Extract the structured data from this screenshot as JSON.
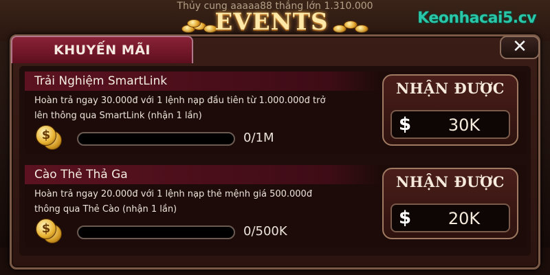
{
  "header": {
    "ticker_text": "Thủy cung aaaaa88 thắng lớn 1.310.000",
    "events_title": "EVENTS",
    "watermark": "Keonhacai5.cv"
  },
  "panel": {
    "tab_label": "KHUYẾN MÃI",
    "close_label": "✕"
  },
  "promotions": [
    {
      "title": "Trải Nghiệm SmartLink",
      "description_line1": "Hoàn trả ngay 30.000đ với 1 lệnh nạp đầu tiên từ 1.000.000đ trở",
      "description_line2": "lên thông qua SmartLink (nhận 1 lần)",
      "progress_text": "0/1M",
      "progress_fraction": 0,
      "reward_title": "NHẬN ĐƯỢC",
      "reward_amount": "30K",
      "coin_symbol": "$",
      "currency_symbol": "$"
    },
    {
      "title": "Cào Thẻ Thả Ga",
      "description_line1": "Hoàn trả ngay 20.000đ với 1 lệnh nạp thẻ mệnh giá 500.000đ",
      "description_line2": "thông qua Thẻ Cào (nhận 1 lần)",
      "progress_text": "0/500K",
      "progress_fraction": 0,
      "reward_title": "NHẬN ĐƯỢC",
      "reward_amount": "20K",
      "coin_symbol": "$",
      "currency_symbol": "$"
    }
  ],
  "colors": {
    "tab_bg": "#8a2236",
    "gold": "#e8b230",
    "watermark": "#29c7a8"
  }
}
